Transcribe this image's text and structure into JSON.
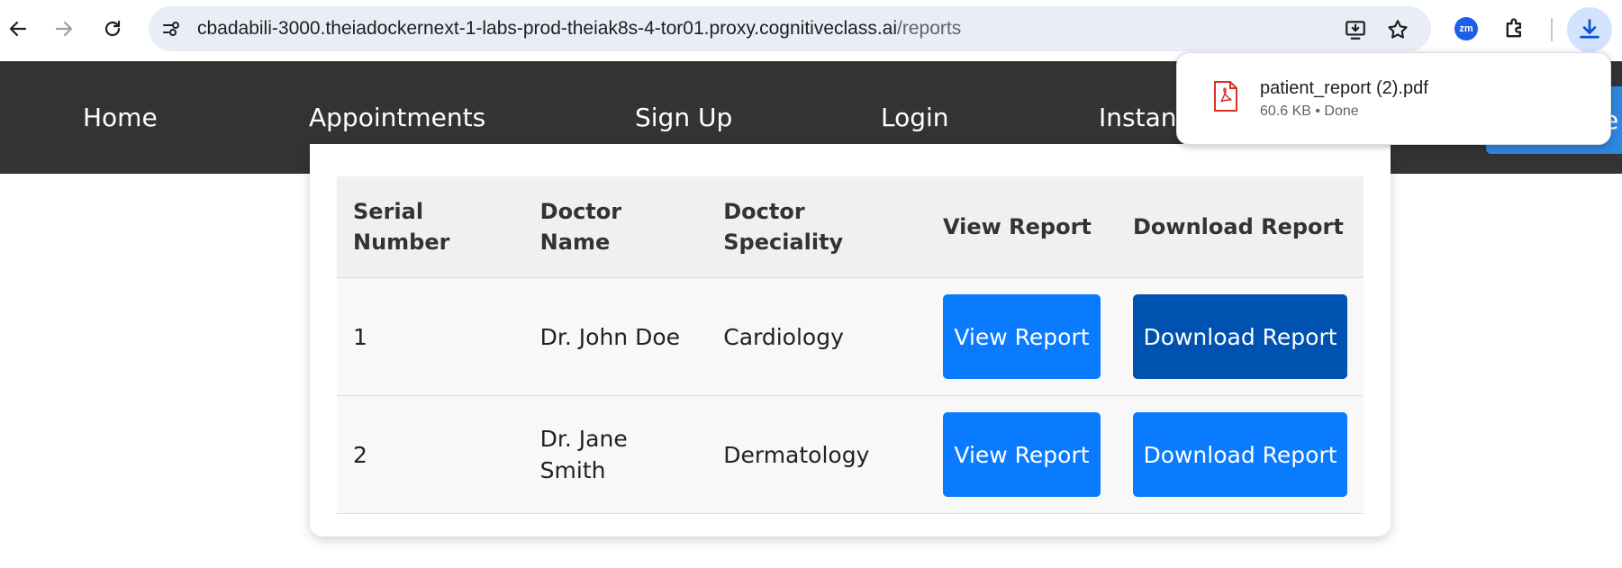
{
  "browser": {
    "url_host": "cbadabili-3000.theiadockernext-1-labs-prod-theiak8s-4-tor01.proxy.cognitiveclass.ai",
    "url_path": "/reports",
    "extension_badge": "zm"
  },
  "nav": {
    "items": [
      {
        "label": "Home"
      },
      {
        "label": "Appointments"
      },
      {
        "label": "Sign Up"
      },
      {
        "label": "Login"
      },
      {
        "label": "Instant"
      }
    ],
    "cta_fragment": "e"
  },
  "table": {
    "headers": [
      "Serial Number",
      "Doctor Name",
      "Doctor Speciality",
      "View Report",
      "Download Report"
    ],
    "rows": [
      {
        "serial": "1",
        "doctor": "Dr. John Doe",
        "speciality": "Cardiology",
        "view_label": "View Report",
        "download_label": "Download Report"
      },
      {
        "serial": "2",
        "doctor": "Dr. Jane Smith",
        "speciality": "Dermatology",
        "view_label": "View Report",
        "download_label": "Download Report"
      }
    ]
  },
  "download_bubble": {
    "filename": "patient_report (2).pdf",
    "meta": "60.6 KB • Done"
  },
  "colors": {
    "nav_bg": "#333333",
    "button_primary": "#0a7bff",
    "button_pressed": "#0052b0"
  }
}
